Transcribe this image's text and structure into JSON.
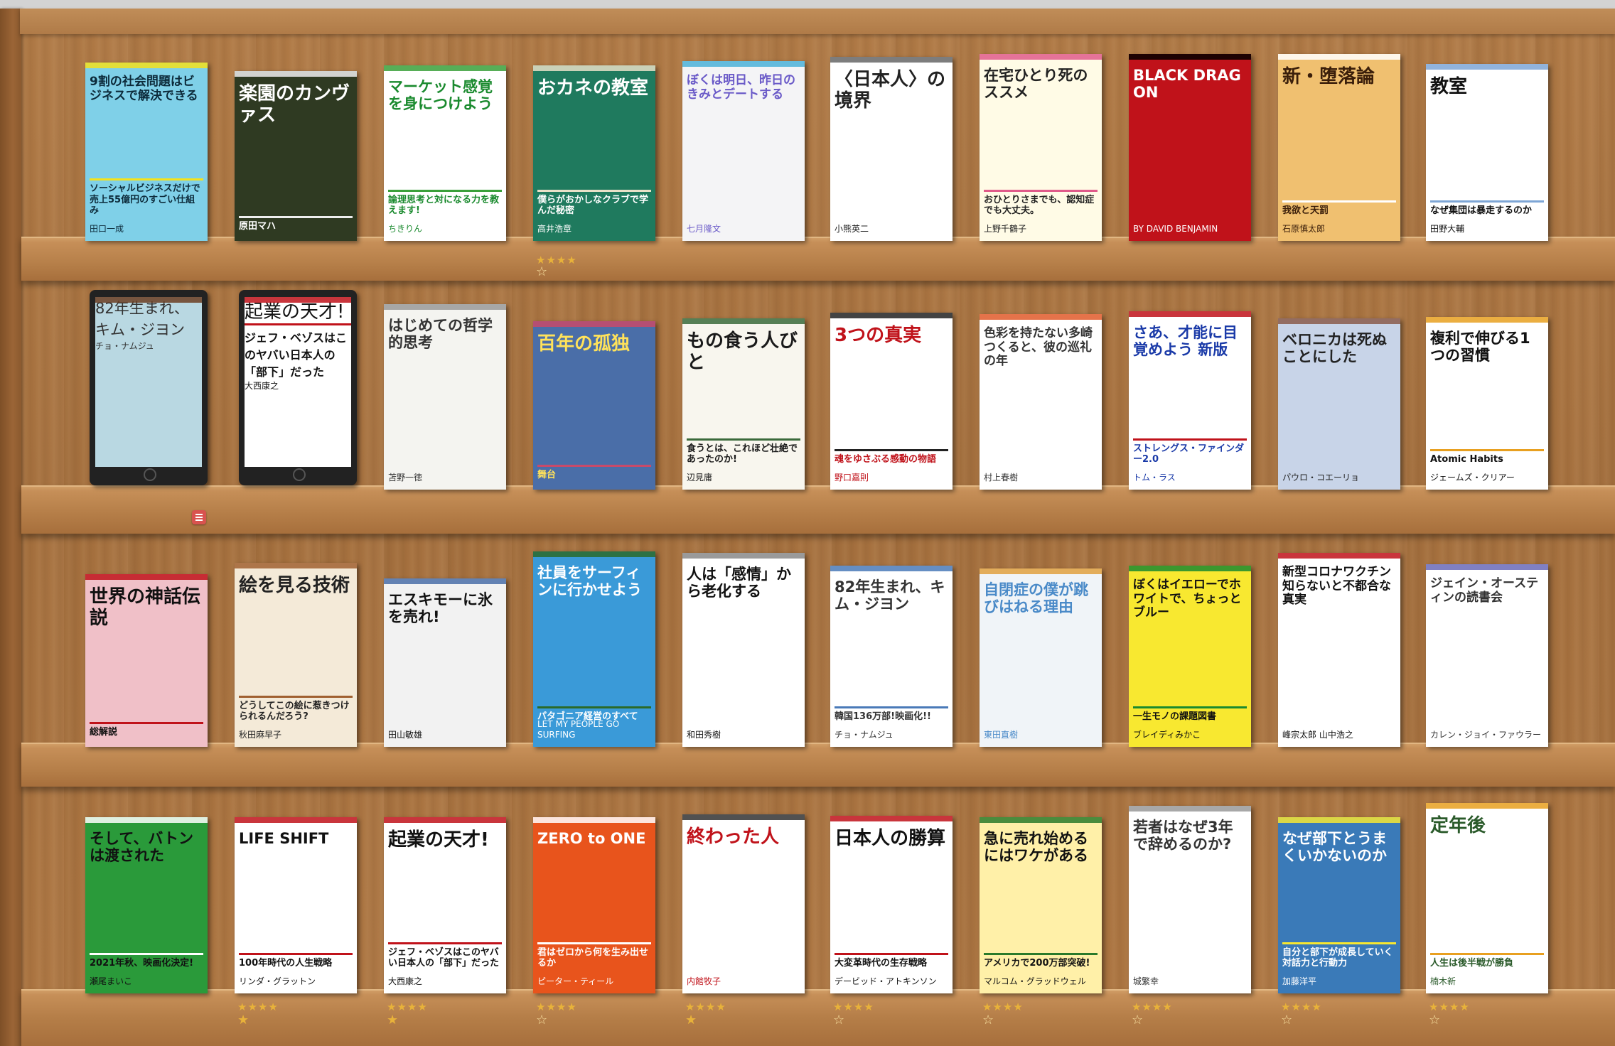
{
  "shelves": [
    {
      "books": [
        {
          "title": "9割の社会問題はビジネスで解決できる",
          "sub": "ソーシャルビジネスだけで売上55億円のすごい仕組み",
          "author": "田口一成",
          "bg": "#7fd0e8",
          "fg": "#0c2a3a",
          "accent": "#f5e21a"
        },
        {
          "title": "楽園のカンヴァス",
          "sub": "原田マハ",
          "bg": "#2f3a22",
          "fg": "#ffffff",
          "accent": "#eeeeee"
        },
        {
          "title": "マーケット感覚を身につけよう",
          "sub": "論理思考と対になる力を教えます!",
          "author": "ちきりん",
          "bg": "#ffffff",
          "fg": "#1a8a2e",
          "accent": "#3aa03a"
        },
        {
          "title": "おカネの教室",
          "sub": "僕らがおかしなクラブで学んだ秘密",
          "author": "高井浩章",
          "bg": "#1f7a5e",
          "fg": "#ffffff",
          "accent": "#e9e1c8"
        },
        {
          "title": "ぼくは明日、昨日のきみとデートする",
          "author": "七月隆文",
          "bg": "#f4f4f6",
          "fg": "#6a5ac8",
          "accent": "#4ab0d8"
        },
        {
          "title": "〈日本人〉の境界",
          "author": "小熊英二",
          "bg": "#ffffff",
          "fg": "#222222",
          "accent": "#666666"
        },
        {
          "title": "在宅ひとり死のススメ",
          "author": "上野千鶴子",
          "sub": "おひとりさまでも、認知症でも大丈夫。",
          "bg": "#fffbe6",
          "fg": "#222222",
          "accent": "#e05a8a"
        },
        {
          "title": "BLACK DRAGON",
          "author": "BY DAVID BENJAMIN",
          "bg": "#c0121a",
          "fg": "#ffffff",
          "accent": "#000000"
        },
        {
          "title": "新・堕落論",
          "author": "石原慎太郎",
          "sub": "我欲と天罰",
          "bg": "#f0c070",
          "fg": "#3a1e0a",
          "accent": "#ffffff"
        },
        {
          "title": "教室",
          "sub": "なぜ集団は暴走するのか",
          "author": "田野大輔",
          "bg": "#ffffff",
          "fg": "#111111",
          "accent": "#7ea6d6"
        }
      ],
      "ratings": [
        {
          "index": 3,
          "filled": "★★★★",
          "empty": "☆"
        }
      ]
    },
    {
      "books": [
        {
          "title": "82年生まれ、キム・ジヨン",
          "author": "チョ・ナムジュ",
          "bg": "#b9d8e2",
          "fg": "#333333",
          "accent": "#6b3e22",
          "tablet": true
        },
        {
          "title": "起業の天才!",
          "sub": "ジェフ・ベゾスはこのヤバい日本人の「部下」だった",
          "author": "大西康之",
          "bg": "#ffffff",
          "fg": "#111111",
          "accent": "#c0121a",
          "tablet": true
        },
        {
          "title": "はじめての哲学的思考",
          "author": "苫野一徳",
          "bg": "#f4f4f0",
          "fg": "#333333",
          "accent": "#999999"
        },
        {
          "title": "百年の孤独",
          "sub": "舞台",
          "bg": "#4a6ea8",
          "fg": "#ffe25a",
          "accent": "#c84a6a"
        },
        {
          "title": "もの食う人びと",
          "author": "辺見庸",
          "sub": "食うとは、これほど壮絶であったのか!",
          "bg": "#f8f6ee",
          "fg": "#1a1a1a",
          "accent": "#3a6a3a"
        },
        {
          "title": "3つの真実",
          "sub": "魂をゆさぶる感動の物語",
          "author": "野口嘉則",
          "bg": "#ffffff",
          "fg": "#c0121a",
          "accent": "#222222"
        },
        {
          "title": "色彩を持たない多崎つくると、彼の巡礼の年",
          "author": "村上春樹",
          "bg": "#ffffff",
          "fg": "#333333",
          "accent": "#e05a2a"
        },
        {
          "title": "さあ、才能に目覚めよう 新版",
          "sub": "ストレングス・ファインダー2.0",
          "author": "トム・ラス",
          "bg": "#ffffff",
          "fg": "#1a3aa8",
          "accent": "#c0121a"
        },
        {
          "title": "ベロニカは死ぬことにした",
          "author": "パウロ・コエーリョ",
          "bg": "#c8d4e8",
          "fg": "#222222",
          "accent": "#8a5a4a"
        },
        {
          "title": "複利で伸びる1つの習慣",
          "sub": "Atomic Habits",
          "author": "ジェームズ・クリアー",
          "bg": "#ffffff",
          "fg": "#111111",
          "accent": "#e8a020"
        }
      ],
      "ratings": []
    },
    {
      "books": [
        {
          "title": "世界の神話伝説",
          "sub": "総解説",
          "bg": "#f0c0c8",
          "fg": "#111111",
          "accent": "#c0121a"
        },
        {
          "title": "絵を見る技術",
          "author": "秋田麻早子",
          "sub": "どうしてこの絵に惹きつけられるんだろう?",
          "bg": "#f4ead8",
          "fg": "#222222",
          "accent": "#a06030"
        },
        {
          "title": "エスキモーに氷を売れ!",
          "author": "田山敏雄",
          "bg": "#f2f2f2",
          "fg": "#111111",
          "accent": "#4a6ea8"
        },
        {
          "title": "社員をサーフィンに行かせよう",
          "sub": "パタゴニア経営のすべて",
          "author": "LET MY PEOPLE GO SURFING",
          "bg": "#3a9ad8",
          "fg": "#ffffff",
          "accent": "#2a6a2a"
        },
        {
          "title": "人は「感情」から老化する",
          "author": "和田秀樹",
          "bg": "#ffffff",
          "fg": "#111111",
          "accent": "#888888"
        },
        {
          "title": "82年生まれ、キム・ジヨン",
          "sub": "韓国136万部!映画化!!",
          "author": "チョ・ナムジュ",
          "bg": "#ffffff",
          "fg": "#333333",
          "accent": "#4a7ab8"
        },
        {
          "title": "自閉症の僕が跳びはねる理由",
          "author": "東田直樹",
          "bg": "#f0f4f8",
          "fg": "#4a8ac8",
          "accent": "#e0a040"
        },
        {
          "title": "ぼくはイエローでホワイトで、ちょっとブルー",
          "sub": "一生モノの課題図書",
          "author": "ブレイディみかこ",
          "bg": "#f8e830",
          "fg": "#111111",
          "accent": "#1a8a2e"
        },
        {
          "title": "新型コロナワクチン 知らないと不都合な真実",
          "author": "峰宗太郎 山中浩之",
          "bg": "#ffffff",
          "fg": "#111111",
          "accent": "#c0121a"
        },
        {
          "title": "ジェイン・オースティンの読書会",
          "author": "カレン・ジョイ・ファウラー",
          "bg": "#ffffff",
          "fg": "#333333",
          "accent": "#6a6ab8"
        }
      ],
      "ratings": []
    },
    {
      "books": [
        {
          "title": "そして、バトンは渡された",
          "author": "瀬尾まいこ",
          "sub": "2021年秋、映画化決定!",
          "bg": "#2a9a3a",
          "fg": "#111111",
          "accent": "#ffffff"
        },
        {
          "title": "LIFE SHIFT",
          "sub": "100年時代の人生戦略",
          "author": "リンダ・グラットン",
          "bg": "#ffffff",
          "fg": "#111111",
          "accent": "#c0121a"
        },
        {
          "title": "起業の天才!",
          "sub": "ジェフ・ベゾスはこのヤバい日本人の「部下」だった",
          "author": "大西康之",
          "bg": "#ffffff",
          "fg": "#111111",
          "accent": "#c0121a"
        },
        {
          "title": "ZERO to ONE",
          "sub": "君はゼロから何を生み出せるか",
          "author": "ピーター・ティール",
          "bg": "#e8541c",
          "fg": "#ffffff",
          "accent": "#ffffff"
        },
        {
          "title": "終わった人",
          "author": "内館牧子",
          "bg": "#ffffff",
          "fg": "#c0121a",
          "accent": "#333333"
        },
        {
          "title": "日本人の勝算",
          "sub": "大変革時代の生存戦略",
          "author": "デービッド・アトキンソン",
          "bg": "#ffffff",
          "fg": "#111111",
          "accent": "#c0121a"
        },
        {
          "title": "急に売れ始めるにはワケがある",
          "sub": "アメリカで200万部突破!",
          "author": "マルコム・グラッドウェル",
          "bg": "#fff0a8",
          "fg": "#111111",
          "accent": "#2a7a2a"
        },
        {
          "title": "若者はなぜ3年で辞めるのか?",
          "author": "城繁幸",
          "bg": "#ffffff",
          "fg": "#333333",
          "accent": "#999999"
        },
        {
          "title": "なぜ部下とうまくいかないのか",
          "sub": "自分と部下が成長していく対話力と行動力",
          "author": "加藤洋平",
          "bg": "#3a7ab8",
          "fg": "#ffffff",
          "accent": "#f8e830"
        },
        {
          "title": "定年後",
          "sub": "人生は後半戦が勝負",
          "author": "楠木新",
          "bg": "#ffffff",
          "fg": "#2a5a2a",
          "accent": "#e8a020"
        }
      ],
      "ratings": [
        {
          "index": 1,
          "filled": "★★★★",
          "empty": "★"
        },
        {
          "index": 2,
          "filled": "★★★★",
          "empty": "★"
        },
        {
          "index": 3,
          "filled": "★★★★",
          "empty": "☆"
        },
        {
          "index": 4,
          "filled": "★★★★",
          "empty": "★"
        },
        {
          "index": 5,
          "filled": "★★★★",
          "empty": "☆"
        },
        {
          "index": 6,
          "filled": "★★★★",
          "empty": "☆"
        },
        {
          "index": 7,
          "filled": "★★★★",
          "empty": "☆"
        },
        {
          "index": 8,
          "filled": "★★★★",
          "empty": "☆"
        },
        {
          "index": 9,
          "filled": "★★★★",
          "empty": "☆"
        }
      ]
    }
  ]
}
